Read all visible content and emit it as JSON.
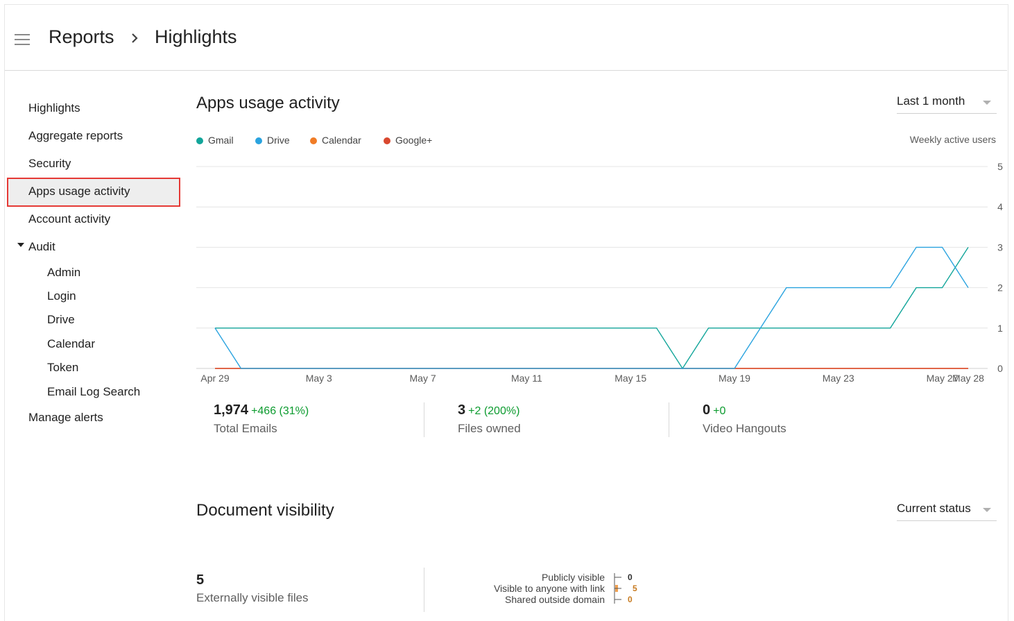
{
  "header": {
    "breadcrumb_root": "Reports",
    "breadcrumb_current": "Highlights"
  },
  "sidebar": {
    "items": [
      {
        "label": "Highlights"
      },
      {
        "label": "Aggregate reports"
      },
      {
        "label": "Security"
      },
      {
        "label": "Apps usage activity",
        "selected": true
      },
      {
        "label": "Account activity"
      },
      {
        "label": "Audit",
        "expanded": true
      },
      {
        "label": "Admin"
      },
      {
        "label": "Login"
      },
      {
        "label": "Drive"
      },
      {
        "label": "Calendar"
      },
      {
        "label": "Token"
      },
      {
        "label": "Email Log Search"
      },
      {
        "label": "Manage alerts"
      }
    ]
  },
  "apps_usage": {
    "title": "Apps usage activity",
    "range_select": "Last 1 month",
    "axis_title": "Weekly active users",
    "legend": [
      {
        "name": "Gmail",
        "color": "#12a59a"
      },
      {
        "name": "Drive",
        "color": "#2aa3df"
      },
      {
        "name": "Calendar",
        "color": "#f07c26"
      },
      {
        "name": "Google+",
        "color": "#d9482f"
      }
    ],
    "stats": [
      {
        "value": "1,974",
        "delta": "+466 (31%)",
        "caption": "Total Emails"
      },
      {
        "value": "3",
        "delta": "+2 (200%)",
        "caption": "Files owned"
      },
      {
        "value": "0",
        "delta": "+0",
        "caption": "Video Hangouts"
      }
    ]
  },
  "chart_data": {
    "type": "line",
    "x_tick_labels": [
      "Apr 29",
      "May 3",
      "May 7",
      "May 11",
      "May 15",
      "May 19",
      "May 23",
      "May 27",
      "May 28"
    ],
    "x": [
      "Apr 29",
      "Apr 30",
      "May 1",
      "May 2",
      "May 3",
      "May 4",
      "May 5",
      "May 6",
      "May 7",
      "May 8",
      "May 9",
      "May 10",
      "May 11",
      "May 12",
      "May 13",
      "May 14",
      "May 15",
      "May 16",
      "May 17",
      "May 18",
      "May 19",
      "May 20",
      "May 21",
      "May 22",
      "May 23",
      "May 24",
      "May 25",
      "May 26",
      "May 27",
      "May 28"
    ],
    "y_ticks": [
      0,
      1,
      2,
      3,
      4,
      5
    ],
    "ylim": [
      0,
      5
    ],
    "ylabel": "Weekly active users",
    "series": [
      {
        "name": "Gmail",
        "color": "#12a59a",
        "values": [
          1,
          1,
          1,
          1,
          1,
          1,
          1,
          1,
          1,
          1,
          1,
          1,
          1,
          1,
          1,
          1,
          1,
          1,
          0,
          1,
          1,
          1,
          1,
          1,
          1,
          1,
          1,
          2,
          2,
          3
        ]
      },
      {
        "name": "Drive",
        "color": "#2aa3df",
        "values": [
          1,
          0,
          0,
          0,
          0,
          0,
          0,
          0,
          0,
          0,
          0,
          0,
          0,
          0,
          0,
          0,
          0,
          0,
          0,
          0,
          0,
          1,
          2,
          2,
          2,
          2,
          2,
          3,
          3,
          2
        ]
      },
      {
        "name": "Calendar",
        "color": "#f07c26",
        "values": [
          0,
          0,
          0,
          0,
          0,
          0,
          0,
          0,
          0,
          0,
          0,
          0,
          0,
          0,
          0,
          0,
          0,
          0,
          0,
          0,
          0,
          0,
          0,
          0,
          0,
          0,
          0,
          0,
          0,
          0
        ]
      },
      {
        "name": "Google+",
        "color": "#d9482f",
        "values": [
          0,
          0,
          0,
          0,
          0,
          0,
          0,
          0,
          0,
          0,
          0,
          0,
          0,
          0,
          0,
          0,
          0,
          0,
          0,
          0,
          0,
          0,
          0,
          0,
          0,
          0,
          0,
          0,
          0,
          0
        ]
      }
    ]
  },
  "document_visibility": {
    "title": "Document visibility",
    "status_select": "Current status",
    "external_value": "5",
    "external_caption": "Externally visible files",
    "breakdown": [
      {
        "label": "Publicly visible",
        "value": "0",
        "color": "#2b2b2b"
      },
      {
        "label": "Visible to anyone with link",
        "value": "5",
        "color": "#c77a1f"
      },
      {
        "label": "Shared outside domain",
        "value": "0",
        "color": "#c77a1f"
      }
    ],
    "bar_color": "#f0a050"
  }
}
